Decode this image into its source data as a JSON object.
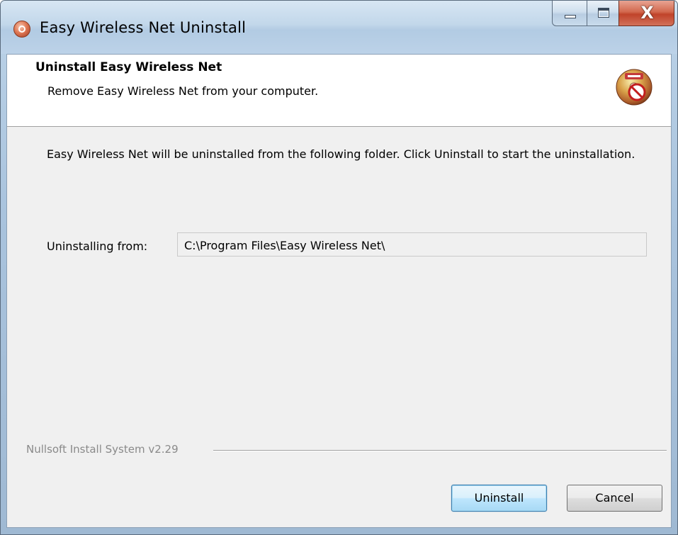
{
  "window": {
    "title": "Easy Wireless Net Uninstall",
    "close_glyph": "X",
    "icons": {
      "app": "uninstaller-app-icon",
      "header": "cd-uninstall-icon",
      "minimize": "minimize-icon",
      "maximize": "maximize-icon",
      "close": "close-icon"
    }
  },
  "header": {
    "title": "Uninstall Easy Wireless Net",
    "subtitle": "Remove Easy Wireless Net from your computer."
  },
  "body": {
    "description": "Easy Wireless Net will be uninstalled from the following folder. Click Uninstall to start the uninstallation.",
    "from_label": "Uninstalling from:",
    "from_value": "C:\\Program Files\\Easy Wireless Net\\"
  },
  "footer": {
    "branding": "Nullsoft Install System v2.29",
    "uninstall_label": "Uninstall",
    "cancel_label": "Cancel"
  },
  "colors": {
    "default_button_border": "#3c7fb1",
    "close_button": "#c0432a",
    "branding_text": "#8a8a8a"
  }
}
